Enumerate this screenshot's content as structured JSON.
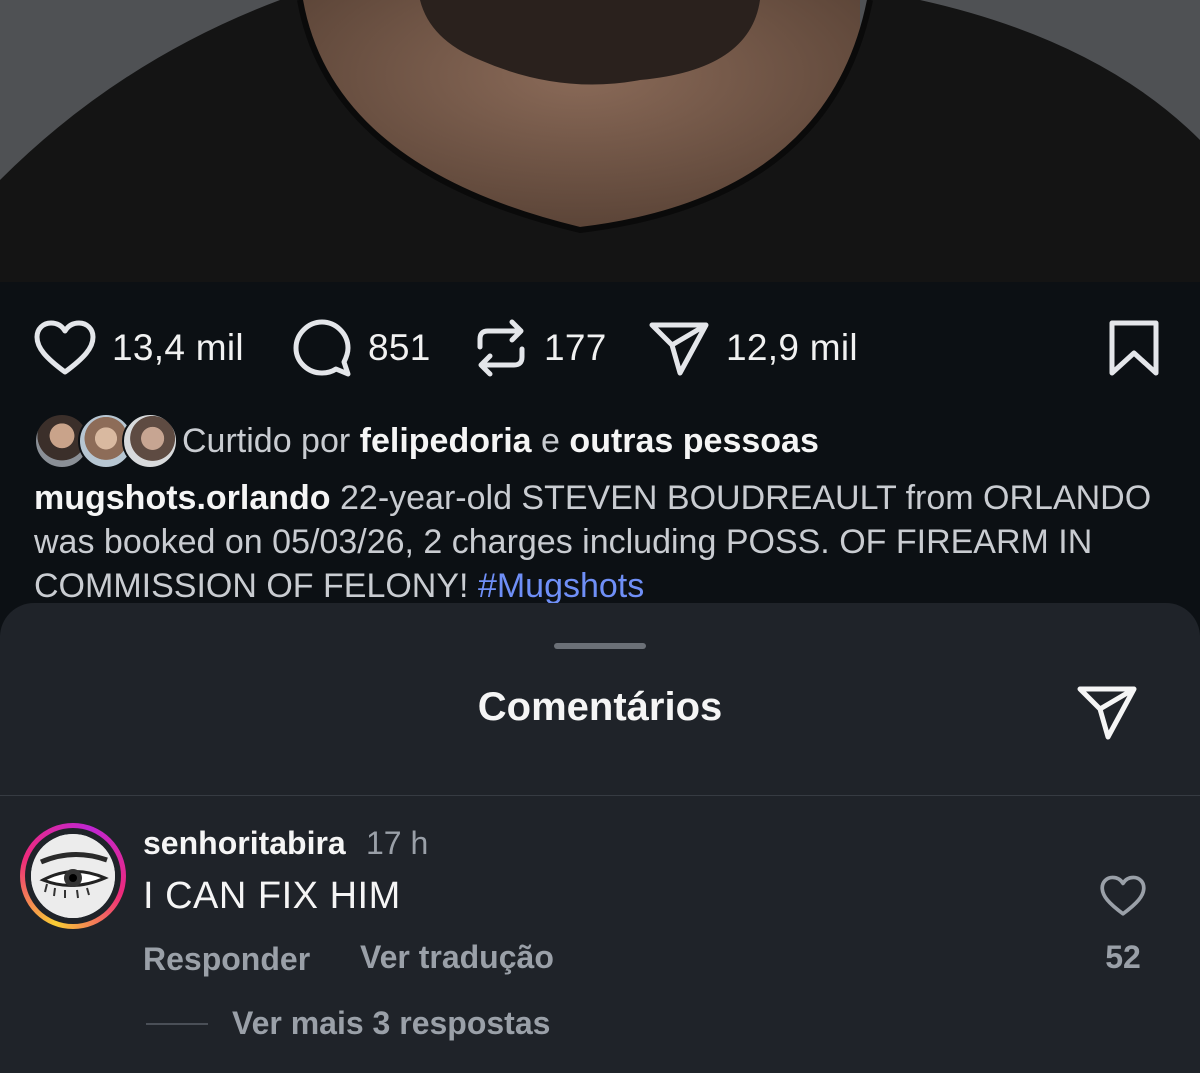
{
  "post": {
    "likes_count": "13,4 mil",
    "comments_count": "851",
    "reposts_count": "177",
    "shares_count": "12,9 mil"
  },
  "liked_by": {
    "prefix": "Curtido por",
    "user": "felipedoria",
    "conj": "e",
    "others": "outras pessoas"
  },
  "caption": {
    "username": "mugshots.orlando",
    "text": " 22-year-old STEVEN BOUDREAULT from ORLANDO was booked on 05/03/26, 2 charges including POSS. OF FIREARM IN COMMISSION OF FELONY! ",
    "hashtag": "#Mugshots"
  },
  "sheet": {
    "title": "Comentários"
  },
  "comment": {
    "username": "senhoritabira",
    "time": "17 h",
    "text": "I CAN FIX HIM",
    "reply_label": "Responder",
    "translate_label": "Ver tradução",
    "like_count": "52",
    "more_replies": "Ver mais 3 respostas"
  },
  "colors": {
    "background": "#0c1014",
    "sheet": "#1f2329",
    "hashtag": "#6f8ff7",
    "muted": "#9aa0a8"
  },
  "icons": [
    "heart-icon",
    "comment-bubble-icon",
    "repost-icon",
    "send-icon",
    "bookmark-icon"
  ]
}
